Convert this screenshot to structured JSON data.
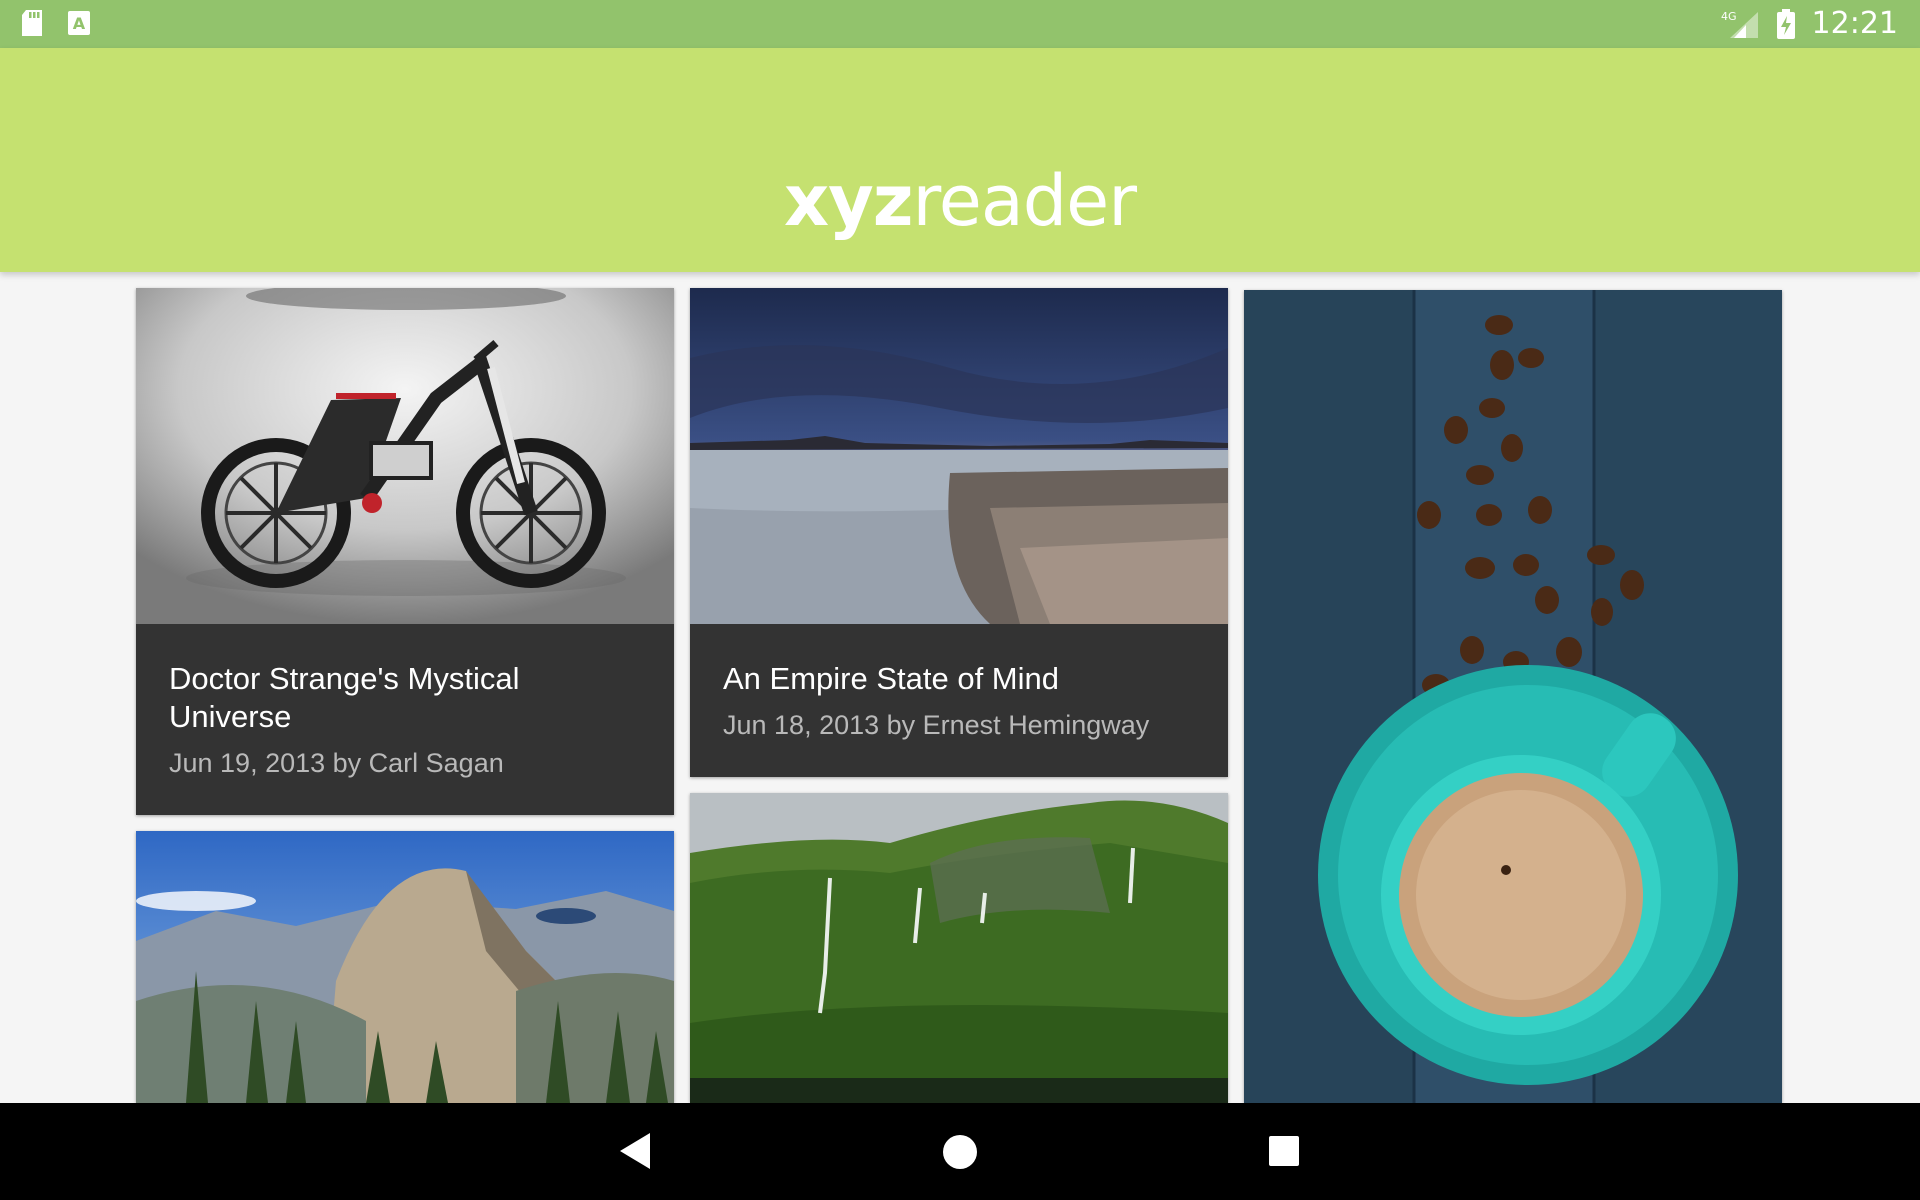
{
  "status_bar": {
    "time": "12:21",
    "network": "4G",
    "icons": [
      "sd-card-icon",
      "keyboard-a-icon",
      "signal-4g-icon",
      "battery-charging-icon"
    ]
  },
  "app_bar": {
    "logo_part1": "xyz",
    "logo_part2": "reader",
    "background_color": "#c5e170",
    "status_color": "#92c36c"
  },
  "articles": [
    {
      "title": "Doctor Strange's Mystical Universe",
      "meta": "Jun 19, 2013 by Carl Sagan",
      "image": "concept electric mountain bike"
    },
    {
      "title": "An Empire State of Mind",
      "meta": "Jun 18, 2013 by Ernest Hemingway",
      "image": "rocky seashore at dusk"
    },
    {
      "title": "",
      "meta": "",
      "image": "coffee cup and beans on blue wood"
    },
    {
      "title": "",
      "meta": "",
      "image": "mountain valley with granite dome"
    },
    {
      "title": "",
      "meta": "",
      "image": "green cliffs with waterfalls"
    }
  ],
  "nav_bar": {
    "icons": [
      "back-icon",
      "home-icon",
      "recents-icon"
    ]
  }
}
